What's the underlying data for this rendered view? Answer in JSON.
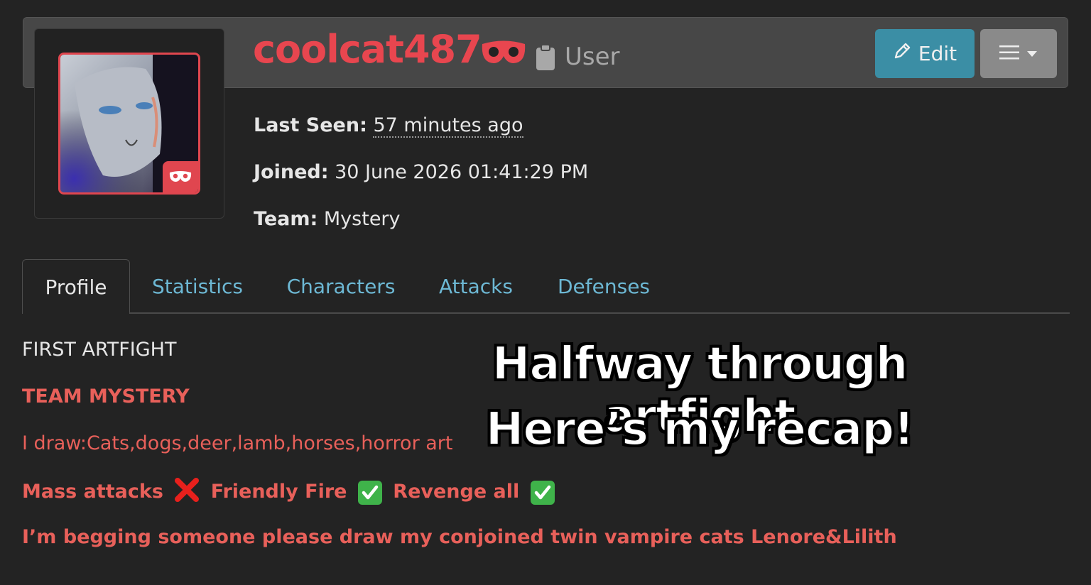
{
  "profile": {
    "username": "coolcat487",
    "role": "User",
    "edit_label": "Edit",
    "last_seen_label": "Last Seen:",
    "last_seen_value": "57 minutes ago",
    "joined_label": "Joined:",
    "joined_value": "30 June 2026 01:41:29 PM",
    "team_label": "Team:",
    "team_value": "Mystery"
  },
  "tabs": [
    {
      "label": "Profile",
      "active": true
    },
    {
      "label": "Statistics",
      "active": false
    },
    {
      "label": "Characters",
      "active": false
    },
    {
      "label": "Attacks",
      "active": false
    },
    {
      "label": "Defenses",
      "active": false
    }
  ],
  "content": {
    "line1": "FIRST ARTFIGHT",
    "line2": "TEAM MYSTERY",
    "line3": "I draw:Cats,dogs,deer,lamb,horses,horror art",
    "mass_attacks": "Mass attacks",
    "friendly_fire": "Friendly Fire",
    "revenge_all": "Revenge all",
    "line5": "I’m begging someone please draw my conjoined twin vampire cats Lenore&Lilith"
  },
  "overlay": {
    "line1": "Halfway through artfight",
    "line2": "Here’s my recap!"
  },
  "colors": {
    "background": "#232323",
    "accent_red": "#e8464f",
    "link_blue": "#6db8d4",
    "edit_button": "#3b8ea5"
  }
}
